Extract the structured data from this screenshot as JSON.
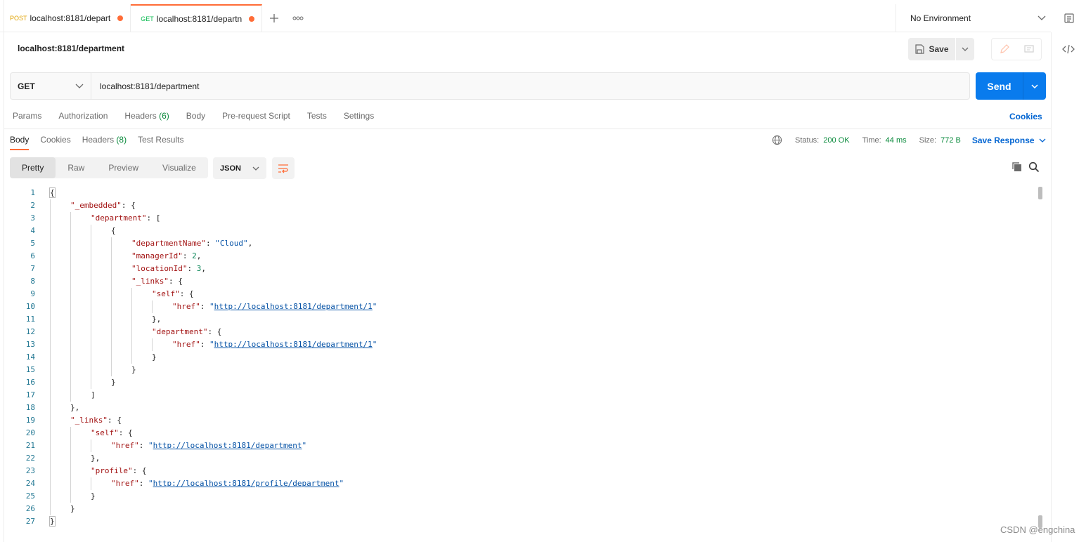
{
  "tabs": [
    {
      "method": "POST",
      "title": "localhost:8181/depart",
      "active": false
    },
    {
      "method": "GET",
      "title": "localhost:8181/departn",
      "active": true
    }
  ],
  "environment": {
    "label": "No Environment"
  },
  "request": {
    "title": "localhost:8181/department",
    "method": "GET",
    "url": "localhost:8181/department"
  },
  "toolbar": {
    "save_label": "Save",
    "send_label": "Send"
  },
  "request_tabs": {
    "params": "Params",
    "authorization": "Authorization",
    "headers": "Headers",
    "headers_count": "(6)",
    "body": "Body",
    "prerequest": "Pre-request Script",
    "tests": "Tests",
    "settings": "Settings",
    "cookies": "Cookies"
  },
  "response_tabs": {
    "body": "Body",
    "cookies": "Cookies",
    "headers": "Headers",
    "headers_count": "(8)",
    "test_results": "Test Results"
  },
  "response_meta": {
    "status_label": "Status:",
    "status_value": "200 OK",
    "time_label": "Time:",
    "time_value": "44 ms",
    "size_label": "Size:",
    "size_value": "772 B",
    "save_response": "Save Response"
  },
  "format": {
    "pretty": "Pretty",
    "raw": "Raw",
    "preview": "Preview",
    "visualize": "Visualize",
    "language": "JSON"
  },
  "code_lines": [
    {
      "n": "1",
      "i": 0,
      "t": [
        [
          "p",
          "{"
        ]
      ]
    },
    {
      "n": "2",
      "i": 1,
      "t": [
        [
          "k",
          "\"_embedded\""
        ],
        [
          "p",
          ": {"
        ]
      ]
    },
    {
      "n": "3",
      "i": 2,
      "t": [
        [
          "k",
          "\"department\""
        ],
        [
          "p",
          ": ["
        ]
      ]
    },
    {
      "n": "4",
      "i": 3,
      "t": [
        [
          "p",
          "{"
        ]
      ]
    },
    {
      "n": "5",
      "i": 4,
      "t": [
        [
          "k",
          "\"departmentName\""
        ],
        [
          "p",
          ": "
        ],
        [
          "s",
          "\"Cloud\""
        ],
        [
          "p",
          ","
        ]
      ]
    },
    {
      "n": "6",
      "i": 4,
      "t": [
        [
          "k",
          "\"managerId\""
        ],
        [
          "p",
          ": "
        ],
        [
          "d",
          "2"
        ],
        [
          "p",
          ","
        ]
      ]
    },
    {
      "n": "7",
      "i": 4,
      "t": [
        [
          "k",
          "\"locationId\""
        ],
        [
          "p",
          ": "
        ],
        [
          "d",
          "3"
        ],
        [
          "p",
          ","
        ]
      ]
    },
    {
      "n": "8",
      "i": 4,
      "t": [
        [
          "k",
          "\"_links\""
        ],
        [
          "p",
          ": {"
        ]
      ]
    },
    {
      "n": "9",
      "i": 5,
      "t": [
        [
          "k",
          "\"self\""
        ],
        [
          "p",
          ": {"
        ]
      ]
    },
    {
      "n": "10",
      "i": 6,
      "t": [
        [
          "k",
          "\"href\""
        ],
        [
          "p",
          ": "
        ],
        [
          "s",
          "\""
        ],
        [
          "u",
          "http://localhost:8181/department/1"
        ],
        [
          "s",
          "\""
        ]
      ]
    },
    {
      "n": "11",
      "i": 5,
      "t": [
        [
          "p",
          "},"
        ]
      ]
    },
    {
      "n": "12",
      "i": 5,
      "t": [
        [
          "k",
          "\"department\""
        ],
        [
          "p",
          ": {"
        ]
      ]
    },
    {
      "n": "13",
      "i": 6,
      "t": [
        [
          "k",
          "\"href\""
        ],
        [
          "p",
          ": "
        ],
        [
          "s",
          "\""
        ],
        [
          "u",
          "http://localhost:8181/department/1"
        ],
        [
          "s",
          "\""
        ]
      ]
    },
    {
      "n": "14",
      "i": 5,
      "t": [
        [
          "p",
          "}"
        ]
      ]
    },
    {
      "n": "15",
      "i": 4,
      "t": [
        [
          "p",
          "}"
        ]
      ]
    },
    {
      "n": "16",
      "i": 3,
      "t": [
        [
          "p",
          "}"
        ]
      ]
    },
    {
      "n": "17",
      "i": 2,
      "t": [
        [
          "p",
          "]"
        ]
      ]
    },
    {
      "n": "18",
      "i": 1,
      "t": [
        [
          "p",
          "},"
        ]
      ]
    },
    {
      "n": "19",
      "i": 1,
      "t": [
        [
          "k",
          "\"_links\""
        ],
        [
          "p",
          ": {"
        ]
      ]
    },
    {
      "n": "20",
      "i": 2,
      "t": [
        [
          "k",
          "\"self\""
        ],
        [
          "p",
          ": {"
        ]
      ]
    },
    {
      "n": "21",
      "i": 3,
      "t": [
        [
          "k",
          "\"href\""
        ],
        [
          "p",
          ": "
        ],
        [
          "s",
          "\""
        ],
        [
          "u",
          "http://localhost:8181/department"
        ],
        [
          "s",
          "\""
        ]
      ]
    },
    {
      "n": "22",
      "i": 2,
      "t": [
        [
          "p",
          "},"
        ]
      ]
    },
    {
      "n": "23",
      "i": 2,
      "t": [
        [
          "k",
          "\"profile\""
        ],
        [
          "p",
          ": {"
        ]
      ]
    },
    {
      "n": "24",
      "i": 3,
      "t": [
        [
          "k",
          "\"href\""
        ],
        [
          "p",
          ": "
        ],
        [
          "s",
          "\""
        ],
        [
          "u",
          "http://localhost:8181/profile/department"
        ],
        [
          "s",
          "\""
        ]
      ]
    },
    {
      "n": "25",
      "i": 2,
      "t": [
        [
          "p",
          "}"
        ]
      ]
    },
    {
      "n": "26",
      "i": 1,
      "t": [
        [
          "p",
          "}"
        ]
      ]
    },
    {
      "n": "27",
      "i": 0,
      "t": [
        [
          "p",
          "}"
        ]
      ]
    }
  ],
  "watermark": "CSDN @engchina",
  "colors": {
    "accent": "#ff6c37",
    "send": "#097bed",
    "link": "#0265d2",
    "status_ok": "#0a8a3c"
  }
}
